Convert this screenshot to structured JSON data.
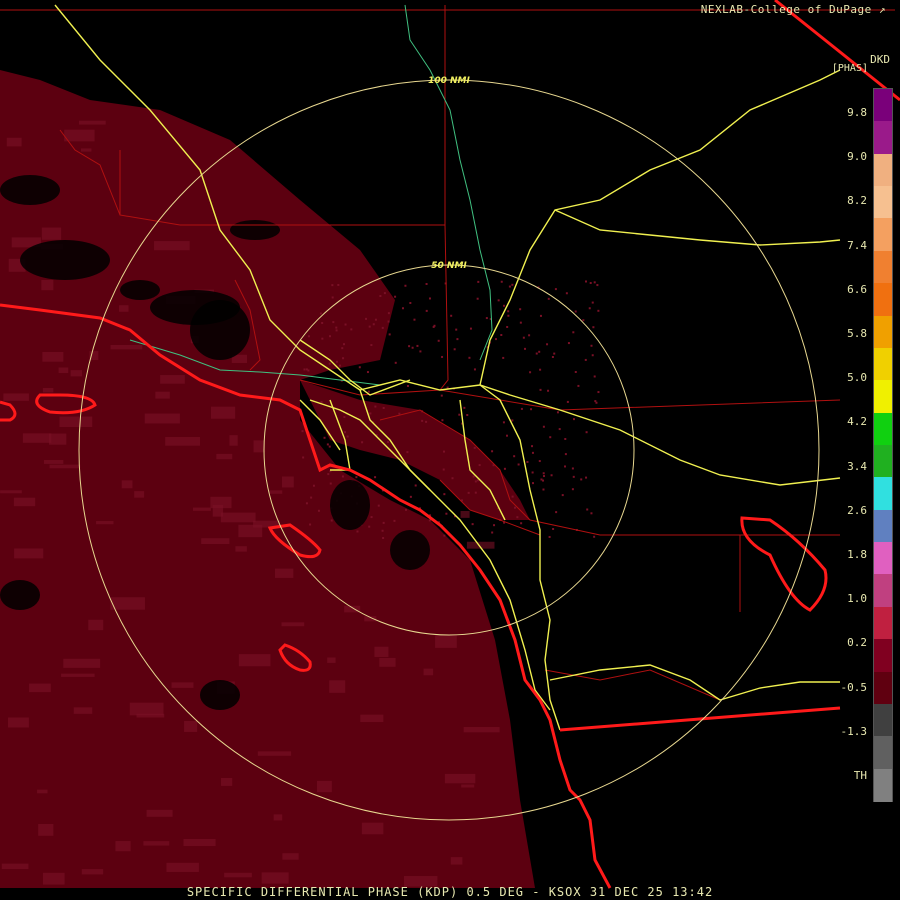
{
  "header": {
    "credit": "NEXLAB-College of DuPage",
    "credit_icon": "arrow-icon",
    "product_code": "DKD",
    "units": "[PHAS]"
  },
  "footer": {
    "caption": "SPECIFIC DIFFERENTIAL PHASE (KDP) 0.5 DEG - KSOX 31 DEC 25 13:42"
  },
  "range_rings": {
    "inner_label": "50 NMI",
    "outer_label": "100 NMI"
  },
  "legend": {
    "ticks": [
      "9.8",
      "9.0",
      "8.2",
      "7.4",
      "6.6",
      "5.8",
      "5.0",
      "4.2",
      "3.4",
      "2.6",
      "1.8",
      "1.0",
      "0.2",
      "-0.5",
      "-1.3",
      "TH"
    ],
    "colors": [
      "#7a007a",
      "#9a1a8a",
      "#f0b080",
      "#f6c090",
      "#f4a060",
      "#f08030",
      "#f07010",
      "#f0a000",
      "#f0d000",
      "#f0f000",
      "#10d010",
      "#20b020",
      "#30e0e0",
      "#6080c0",
      "#e060c0",
      "#c04080",
      "#c02040",
      "#800020",
      "#600010",
      "#404040",
      "#606060",
      "#808080"
    ],
    "tick_icon": "none"
  },
  "map_colors": {
    "echo": "#5c0010",
    "echo_bright": "#7a1026",
    "highway": "#f0f050",
    "county_line": "#b01010",
    "coast": "#ff1a1a",
    "ring": "#e8d890",
    "river": "#40c080"
  }
}
